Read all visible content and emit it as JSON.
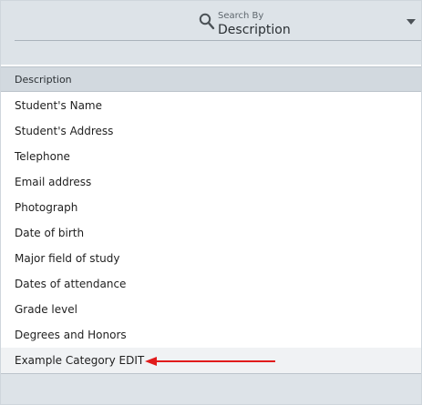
{
  "search": {
    "label": "Search By",
    "value": "Description"
  },
  "table": {
    "header": "Description",
    "rows": [
      "Student's Name",
      "Student's Address",
      "Telephone",
      "Email address",
      "Photograph",
      "Date of birth",
      "Major field of study",
      "Dates of attendance",
      "Grade level",
      "Degrees and Honors",
      "Example Category EDIT"
    ],
    "selected_row_index": 10
  },
  "colors": {
    "header_bg": "#dde3e8",
    "column_header_bg": "#d2d9df",
    "annotation_arrow": "#e11b1b"
  },
  "icons": {
    "search": "search-icon",
    "dropdown": "chevron-down-icon",
    "annotation": "red-arrow-annotation"
  }
}
